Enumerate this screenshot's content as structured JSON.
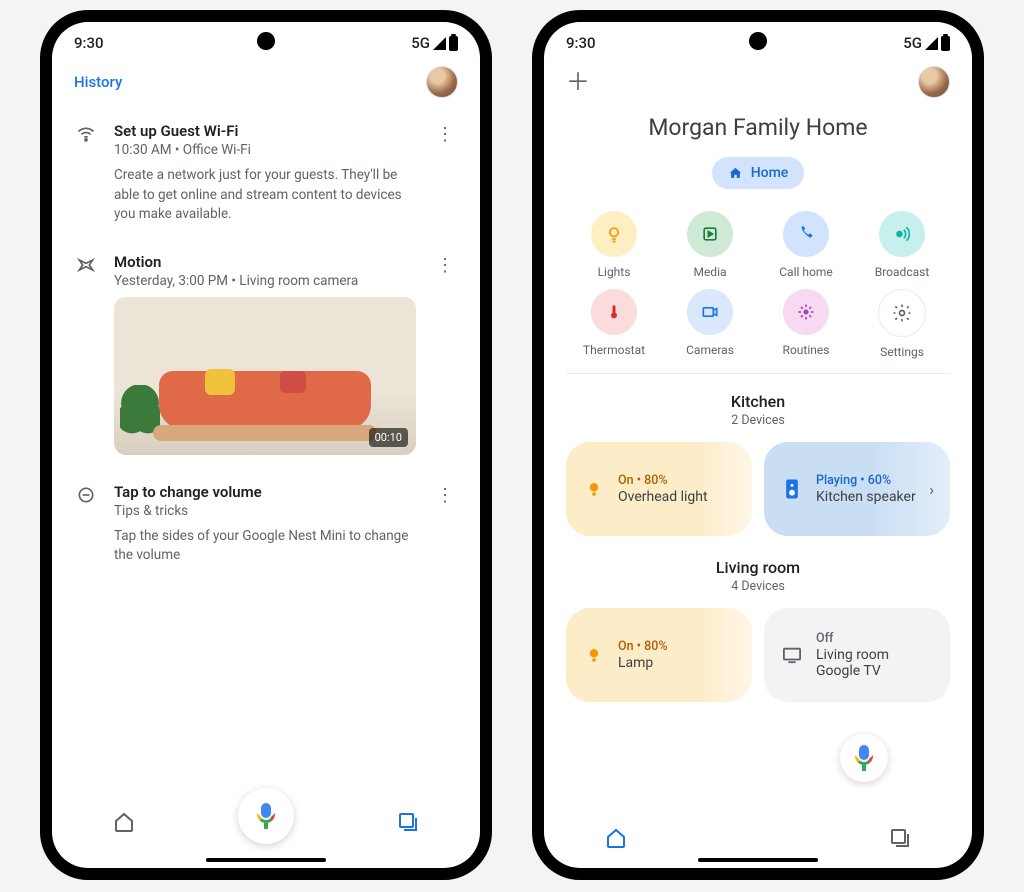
{
  "status": {
    "time": "9:30",
    "net": "5G"
  },
  "left": {
    "history": "History",
    "feed": [
      {
        "title": "Set up Guest Wi-Fi",
        "sub": "10:30 AM • Office Wi-Fi",
        "desc": "Create a network just for your guests. They'll be able to get online and stream content to devices you make available."
      },
      {
        "title": "Motion",
        "sub": "Yesterday, 3:00 PM • Living room camera",
        "video_time": "00:10"
      },
      {
        "title": "Tap to change volume",
        "sub": "Tips & tricks",
        "desc": "Tap the sides of your Google Nest Mini to change the volume"
      }
    ]
  },
  "right": {
    "home_name": "Morgan Family Home",
    "chip": "Home",
    "shortcuts": [
      "Lights",
      "Media",
      "Call home",
      "Broadcast",
      "Thermostat",
      "Cameras",
      "Routines",
      "Settings"
    ],
    "rooms": [
      {
        "name": "Kitchen",
        "count": "2 Devices",
        "devices": [
          {
            "status": "On • 80%",
            "name": "Overhead light",
            "style": "warm",
            "icon": "bulb"
          },
          {
            "status": "Playing • 60%",
            "name": "Kitchen speaker",
            "style": "blue",
            "icon": "speaker",
            "caret": true
          }
        ]
      },
      {
        "name": "Living room",
        "count": "4 Devices",
        "devices": [
          {
            "status": "On • 80%",
            "name": "Lamp",
            "style": "warm",
            "icon": "bulb"
          },
          {
            "status": "Off",
            "name": "Living room Google TV",
            "style": "grey",
            "icon": "tv"
          }
        ]
      }
    ]
  }
}
